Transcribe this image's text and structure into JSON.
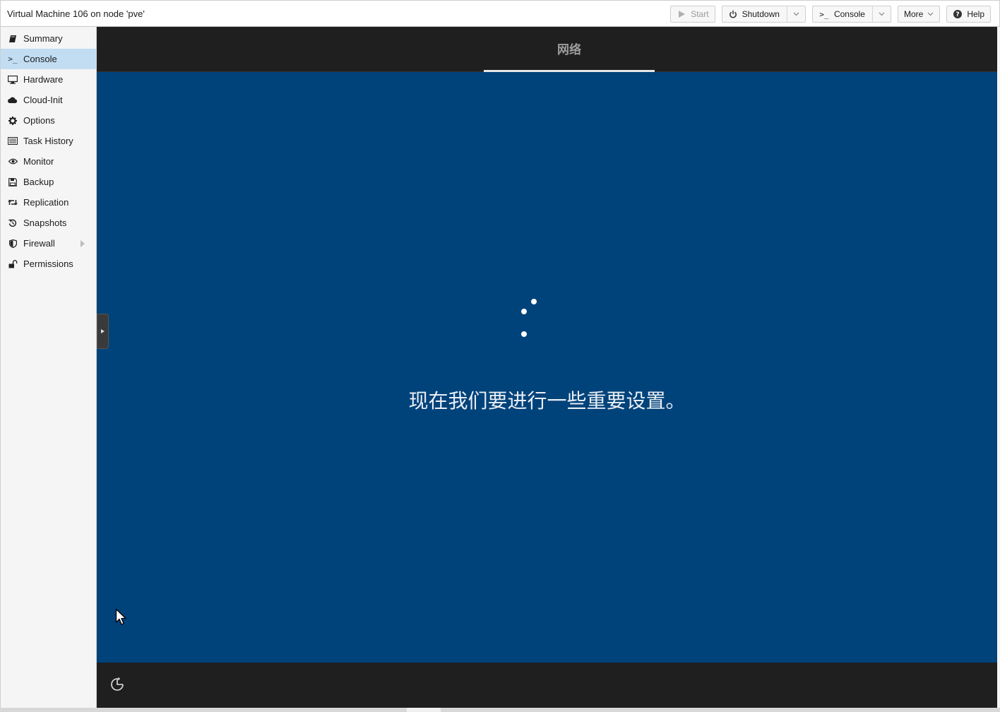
{
  "window": {
    "title": "Virtual Machine 106 on node 'pve'"
  },
  "toolbar": {
    "start_label": "Start",
    "shutdown_label": "Shutdown",
    "console_label": "Console",
    "more_label": "More",
    "help_label": "Help"
  },
  "sidebar": {
    "items": [
      {
        "label": "Summary",
        "icon": "book-icon"
      },
      {
        "label": "Console",
        "icon": "terminal-icon",
        "active": true
      },
      {
        "label": "Hardware",
        "icon": "monitor-icon"
      },
      {
        "label": "Cloud-Init",
        "icon": "cloud-icon"
      },
      {
        "label": "Options",
        "icon": "gear-icon"
      },
      {
        "label": "Task History",
        "icon": "list-icon"
      },
      {
        "label": "Monitor",
        "icon": "eye-icon"
      },
      {
        "label": "Backup",
        "icon": "floppy-icon"
      },
      {
        "label": "Replication",
        "icon": "retweet-icon"
      },
      {
        "label": "Snapshots",
        "icon": "history-icon"
      },
      {
        "label": "Firewall",
        "icon": "shield-icon",
        "has_submenu": true
      },
      {
        "label": "Permissions",
        "icon": "unlock-icon"
      }
    ]
  },
  "console": {
    "tab_label": "网络",
    "message": "现在我们要进行一些重要设置。",
    "background_color": "#00427a",
    "footer_icon": "accessibility-icon"
  }
}
